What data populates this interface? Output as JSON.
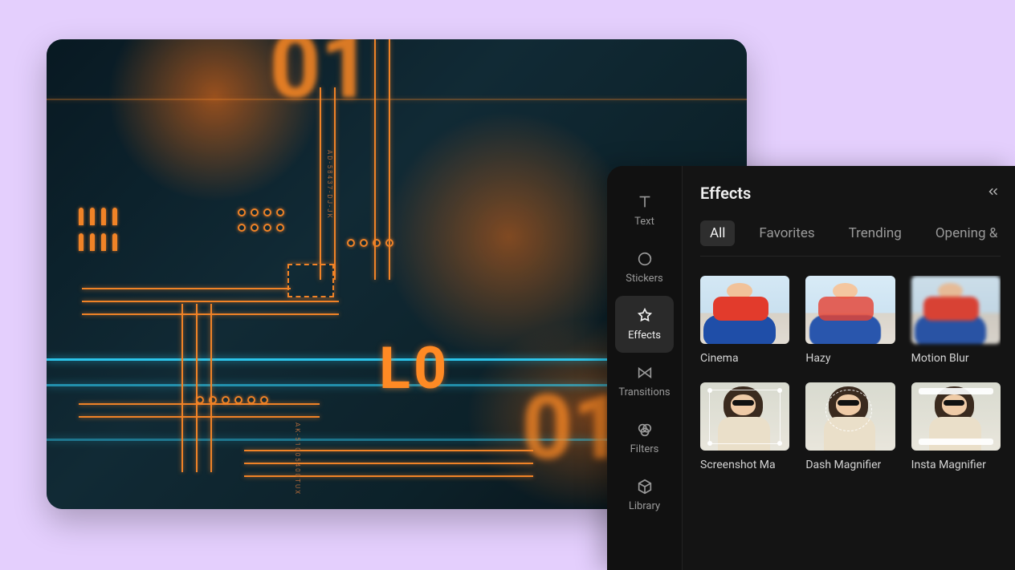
{
  "panel": {
    "title": "Effects",
    "collapse_label": "collapse"
  },
  "sidebar": {
    "items": [
      {
        "id": "text",
        "label": "Text"
      },
      {
        "id": "stickers",
        "label": "Stickers"
      },
      {
        "id": "effects",
        "label": "Effects"
      },
      {
        "id": "transitions",
        "label": "Transitions"
      },
      {
        "id": "filters",
        "label": "Filters"
      },
      {
        "id": "library",
        "label": "Library"
      }
    ],
    "active": "effects"
  },
  "tabs": {
    "items": [
      {
        "id": "all",
        "label": "All"
      },
      {
        "id": "favorites",
        "label": "Favorites"
      },
      {
        "id": "trending",
        "label": "Trending"
      },
      {
        "id": "opening",
        "label": "Opening &"
      }
    ],
    "active": "all"
  },
  "effects": [
    {
      "id": "cinema",
      "label": "Cinema"
    },
    {
      "id": "hazy",
      "label": "Hazy"
    },
    {
      "id": "motionblur",
      "label": "Motion Blur"
    },
    {
      "id": "screenshot",
      "label": "Screenshot Ma"
    },
    {
      "id": "dash",
      "label": "Dash Magnifier"
    },
    {
      "id": "insta",
      "label": "Insta Magnifier"
    }
  ],
  "preview": {
    "text_l0": "L0",
    "text_01_top": "01",
    "text_01_bottom": "01",
    "label_a": "AD-58437-DJ-JK",
    "label_b": "AK-51005400TUX"
  }
}
